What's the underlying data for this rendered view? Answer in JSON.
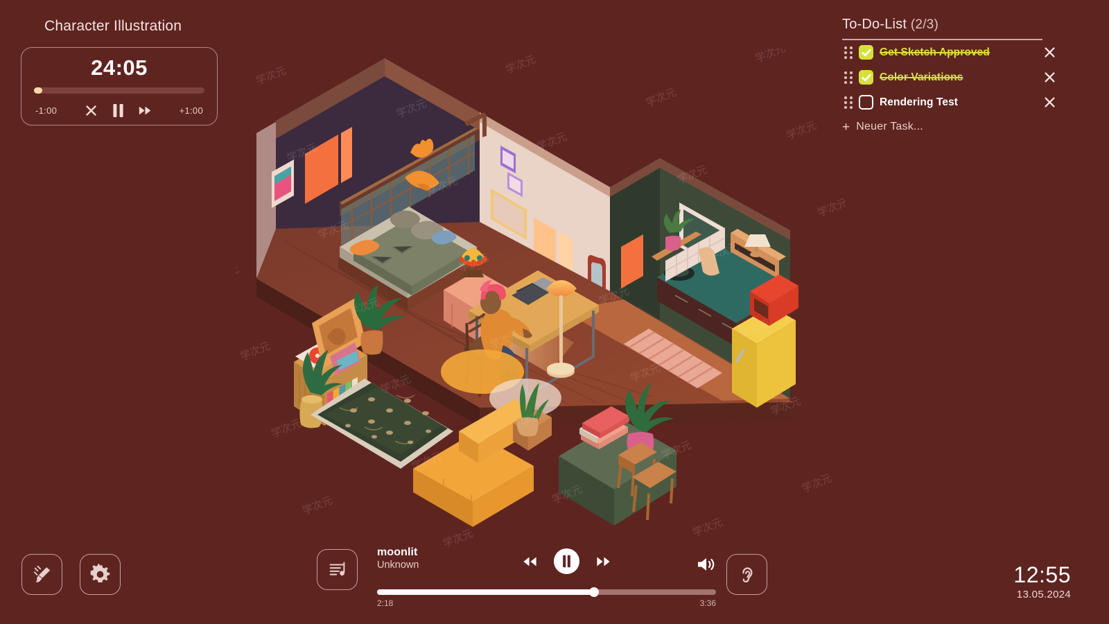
{
  "theme": {
    "background": "#5e2420",
    "accent_check": "#d6e03c",
    "text_primary": "#ffffff",
    "text_muted": "#e5cac6",
    "outline": "#c9a09b"
  },
  "session": {
    "title": "Character Illustration",
    "timer": {
      "value": "24:05",
      "progress_percent": 5,
      "decrease_label": "-1:00",
      "increase_label": "+1:00",
      "buttons": [
        {
          "name": "stop-button",
          "icon": "close-icon"
        },
        {
          "name": "pause-button",
          "icon": "pause-icon"
        },
        {
          "name": "skip-button",
          "icon": "fast-forward-icon"
        }
      ]
    }
  },
  "todo": {
    "title": "To-Do-List",
    "count": "(2/3)",
    "add_label": "Neuer Task...",
    "add_icon": "plus-icon",
    "items": [
      {
        "label": "Get Sketch Approved",
        "done": true
      },
      {
        "label": "Color Variations",
        "done": true
      },
      {
        "label": "Rendering Test",
        "done": false
      }
    ]
  },
  "toolbar": {
    "theme_button": {
      "icon": "paintbrush-icon"
    },
    "settings_button": {
      "icon": "gear-icon"
    },
    "ambient_button": {
      "icon": "ear-icon"
    }
  },
  "player": {
    "artwork_icon": "playlist-music-icon",
    "track_title": "moonlit",
    "track_artist": "Unknown",
    "elapsed": "2:18",
    "duration": "3:36",
    "progress_percent": 64,
    "controls": [
      {
        "name": "previous-button",
        "icon": "rewind-icon"
      },
      {
        "name": "play-pause-button",
        "icon": "pause-circle-icon"
      },
      {
        "name": "next-button",
        "icon": "fast-forward-icon"
      }
    ],
    "volume_icon": "volume-high-icon"
  },
  "clock": {
    "time": "12:55",
    "date": "13.05.2024"
  },
  "illustration": {
    "name": "isometric-room-scene",
    "description": "Cozy isometric studio apartment at sunset with a person working at a laptop",
    "watermark": "学次元"
  }
}
